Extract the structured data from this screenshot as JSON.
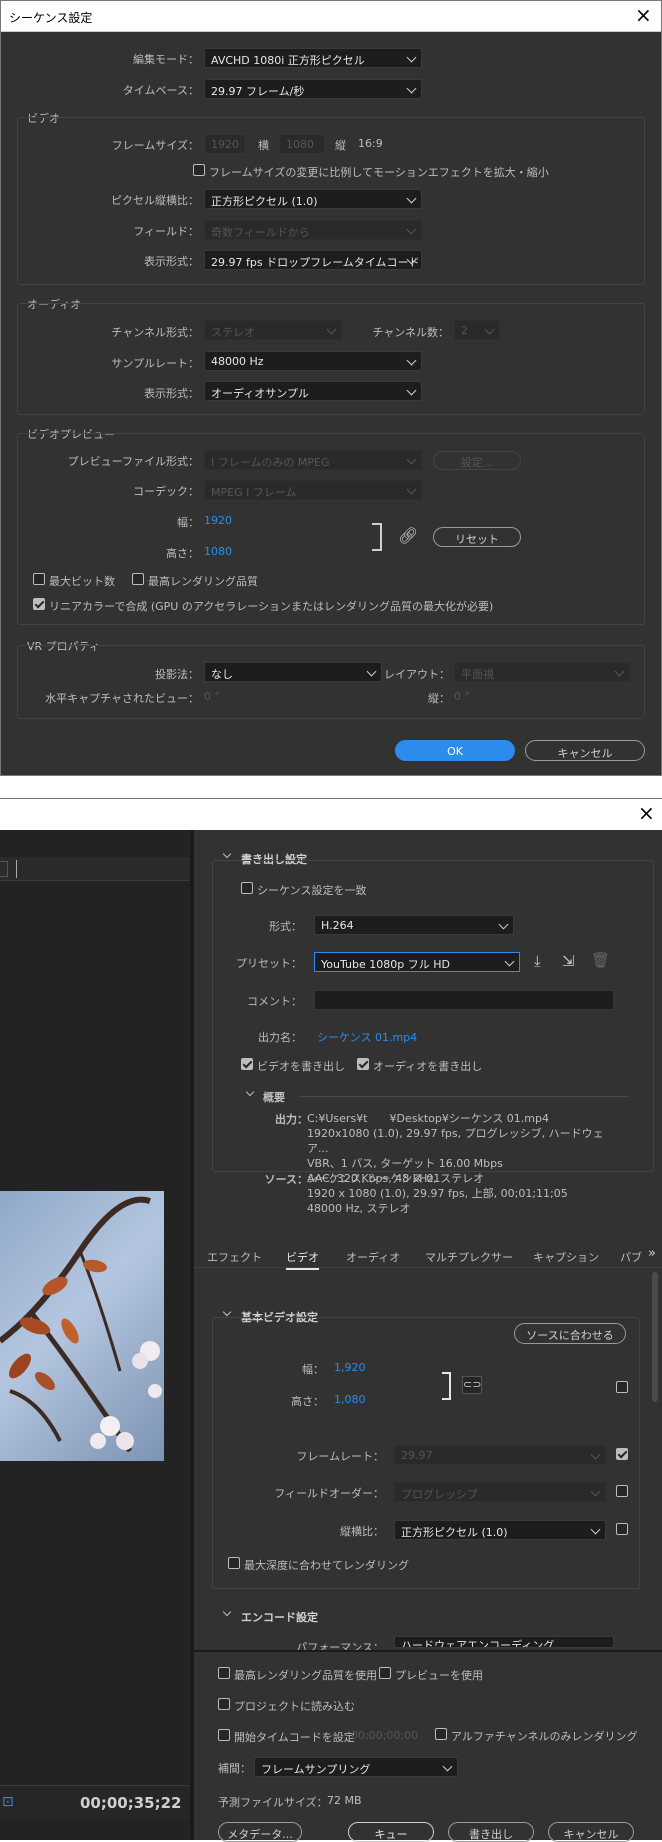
{
  "d1": {
    "title": "シーケンス設定",
    "editing_mode_label": "編集モード：",
    "editing_mode": "AVCHD 1080i 正方形ピクセル",
    "timebase_label": "タイムベース：",
    "timebase": "29.97 フレーム/秒",
    "video_group": "ビデオ",
    "frame_size_label": "フレームサイズ：",
    "frame_w": "1920",
    "w_label": "横",
    "frame_h": "1080",
    "h_label": "縦",
    "aspect": "16:9",
    "scale_motion_label": "フレームサイズの変更に比例してモーションエフェクトを拡大・縮小",
    "pixel_aspect_label": "ピクセル縦横比：",
    "pixel_aspect": "正方形ピクセル (1.0)",
    "field_label": "フィールド：",
    "field": "奇数フィールドから",
    "display_format_label": "表示形式：",
    "display_format": "29.97 fps ドロップフレームタイムコード",
    "audio_group": "オーディオ",
    "channel_format_label": "チャンネル形式：",
    "channel_format": "ステレオ",
    "channel_count_label": "チャンネル数：",
    "channel_count": "2",
    "sample_rate_label": "サンプルレート：",
    "sample_rate": "48000 Hz",
    "audio_display_label": "表示形式：",
    "audio_display": "オーディオサンプル",
    "preview_group": "ビデオプレビュー",
    "preview_file_label": "プレビューファイル形式：",
    "preview_file": "I フレームのみの MPEG",
    "settings_btn": "設定...",
    "codec_label": "コーデック：",
    "codec": "MPEG I フレーム",
    "width_label": "幅：",
    "width": "1920",
    "height_label": "高さ：",
    "height": "1080",
    "reset_btn": "リセット",
    "max_bit_depth": "最大ビット数",
    "max_render_quality": "最高レンダリング品質",
    "linear_color": "リニアカラーで合成 (GPU のアクセラレーションまたはレンダリング品質の最大化が必要)",
    "vr_group": "VR プロパティ",
    "projection_label": "投影法：",
    "projection": "なし",
    "layout_label": "レイアウト：",
    "layout": "平面視",
    "h_capture_label": "水平キャプチャされたビュー：",
    "h_capture": "0 °",
    "v_label": "縦：",
    "v_value": "0 °",
    "ok_btn": "OK",
    "cancel_btn": "キャンセル"
  },
  "d2": {
    "timecode": "00;00;35;22",
    "export_settings": "書き出し設定",
    "match_sequence": "シーケンス設定を一致",
    "format_label": "形式：",
    "format": "H.264",
    "preset_label": "プリセット：",
    "preset": "YouTube  1080p フル HD",
    "comment_label": "コメント：",
    "output_name_label": "出力名：",
    "output_name": "シーケンス 01.mp4",
    "export_video": "ビデオを書き出し",
    "export_audio": "オーディオを書き出し",
    "summary": "概要",
    "output_label": "出力：",
    "output_lines": [
      "C:¥Users¥t　　¥Desktop¥シーケンス 01.mp4",
      "1920x1080 (1.0), 29.97 fps, プログレッシブ, ハードウェア...",
      "VBR、1 パス, ターゲット 16.00 Mbps",
      "AAC, 320 Kbps, 48 kHz, ステレオ"
    ],
    "source_label": "ソース：",
    "source_lines": [
      "シーケンス, シーケンス 01",
      "1920 x 1080 (1.0), 29.97 fps, 上部, 00;01;11;05",
      "48000  Hz, ステレオ"
    ],
    "tabs": [
      "エフェクト",
      "ビデオ",
      "オーディオ",
      "マルチプレクサー",
      "キャプション",
      "パブ"
    ],
    "basic_video": "基本ビデオ設定",
    "match_source_btn": "ソースに合わせる",
    "width_label": "幅：",
    "width": "1,920",
    "height_label": "高さ：",
    "height": "1,080",
    "frame_rate_label": "フレームレート：",
    "frame_rate": "29.97",
    "field_order_label": "フィールドオーダー：",
    "field_order": "プログレッシブ",
    "aspect_label": "縦横比：",
    "aspect": "正方形ピクセル (1.0)",
    "max_depth_render": "最大深度に合わせてレンダリング",
    "encode_settings": "エンコード設定",
    "performance_label": "パフォーマンス：",
    "performance": "ハードウェアエンコーディング",
    "use_max_render": "最高レンダリング品質を使用",
    "use_preview": "プレビューを使用",
    "import_project": "プロジェクトに読み込む",
    "set_start_tc": "開始タイムコードを設定",
    "start_tc": "00;00;00;00",
    "alpha_only": "アルファチャンネルのみレンダリング",
    "interp_label": "補間：",
    "interp": "フレームサンプリング",
    "est_size_label": "予測ファイルサイズ：",
    "est_size": "72 MB",
    "metadata_btn": "メタデータ...",
    "queue_btn": "キュー",
    "export_btn": "書き出し",
    "cancel_btn": "キャンセル"
  },
  "colors": {
    "accent": "#2d8ceb",
    "panel": "#323232",
    "dark": "#262626"
  }
}
